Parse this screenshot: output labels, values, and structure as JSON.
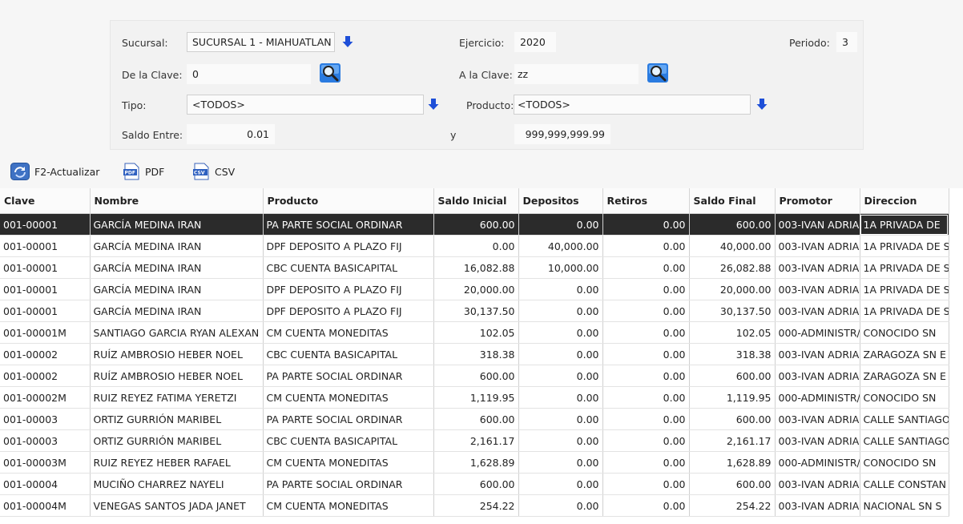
{
  "filters": {
    "sucursal_label": "Sucursal:",
    "sucursal_value": "SUCURSAL 1 - MIAHUATLAN",
    "ejercicio_label": "Ejercicio:",
    "ejercicio_value": "2020",
    "periodo_label": "Periodo:",
    "periodo_value": "3",
    "de_clave_label": "De la Clave:",
    "de_clave_value": "0",
    "a_clave_label": "A la Clave:",
    "a_clave_value": "zz",
    "tipo_label": "Tipo:",
    "tipo_value": "<TODOS>",
    "producto_label": "Producto:",
    "producto_value": "<TODOS>",
    "saldo_label": "Saldo Entre:",
    "saldo_min": "0.01",
    "y_label": "y",
    "saldo_max": "999,999,999.99"
  },
  "toolbar": {
    "refresh_label": "F2-Actualizar",
    "pdf_label": "PDF",
    "csv_label": "CSV"
  },
  "colors": {
    "selected_row": "#2b2b2b",
    "arrow_blue": "#1e4fd8"
  },
  "table": {
    "columns": [
      "Clave",
      "Nombre",
      "Producto",
      "Saldo Inicial",
      "Depositos",
      "Retiros",
      "Saldo Final",
      "Promotor",
      "Direccion"
    ],
    "rows": [
      [
        "001-00001",
        "GARCÍA MEDINA IRAN",
        "PA PARTE SOCIAL ORDINAR",
        "600.00",
        "0.00",
        "0.00",
        "600.00",
        "003-IVAN ADRIA",
        "1A PRIVADA DE"
      ],
      [
        "001-00001",
        "GARCÍA MEDINA IRAN",
        "DPF DEPOSITO A PLAZO FIJ",
        "0.00",
        "40,000.00",
        "0.00",
        "40,000.00",
        "003-IVAN ADRIA",
        "1A PRIVADA DE S"
      ],
      [
        "001-00001",
        "GARCÍA MEDINA IRAN",
        "CBC CUENTA BASICAPITAL",
        "16,082.88",
        "10,000.00",
        "0.00",
        "26,082.88",
        "003-IVAN ADRIA",
        "1A PRIVADA DE S"
      ],
      [
        "001-00001",
        "GARCÍA MEDINA IRAN",
        "DPF DEPOSITO A PLAZO FIJ",
        "20,000.00",
        "0.00",
        "0.00",
        "20,000.00",
        "003-IVAN ADRIA",
        "1A PRIVADA DE S"
      ],
      [
        "001-00001",
        "GARCÍA MEDINA IRAN",
        "DPF DEPOSITO A PLAZO FIJ",
        "30,137.50",
        "0.00",
        "0.00",
        "30,137.50",
        "003-IVAN ADRIA",
        "1A PRIVADA DE S"
      ],
      [
        "001-00001M",
        "SANTIAGO GARCIA RYAN ALEXAN",
        "CM CUENTA MONEDITAS",
        "102.05",
        "0.00",
        "0.00",
        "102.05",
        "000-ADMINISTR/",
        "CONOCIDO SN"
      ],
      [
        "001-00002",
        "RUÍZ AMBROSIO HEBER NOEL",
        "CBC CUENTA BASICAPITAL",
        "318.38",
        "0.00",
        "0.00",
        "318.38",
        "003-IVAN ADRIA",
        "ZARAGOZA SN E"
      ],
      [
        "001-00002",
        "RUÍZ AMBROSIO HEBER NOEL",
        "PA PARTE SOCIAL ORDINAR",
        "600.00",
        "0.00",
        "0.00",
        "600.00",
        "003-IVAN ADRIA",
        "ZARAGOZA SN E"
      ],
      [
        "001-00002M",
        "RUIZ REYEZ FATIMA YERETZI",
        "CM CUENTA MONEDITAS",
        "1,119.95",
        "0.00",
        "0.00",
        "1,119.95",
        "000-ADMINISTR/",
        "CONOCIDO SN"
      ],
      [
        "001-00003",
        "ORTIZ GURRIÓN MARIBEL",
        "PA PARTE SOCIAL ORDINAR",
        "600.00",
        "0.00",
        "0.00",
        "600.00",
        "003-IVAN ADRIA",
        "CALLE SANTIAGO"
      ],
      [
        "001-00003",
        "ORTIZ GURRIÓN MARIBEL",
        "CBC CUENTA BASICAPITAL",
        "2,161.17",
        "0.00",
        "0.00",
        "2,161.17",
        "003-IVAN ADRIA",
        "CALLE SANTIAGO"
      ],
      [
        "001-00003M",
        "RUIZ REYEZ HEBER RAFAEL",
        "CM CUENTA MONEDITAS",
        "1,628.89",
        "0.00",
        "0.00",
        "1,628.89",
        "000-ADMINISTR/",
        "CONOCIDO SN"
      ],
      [
        "001-00004",
        "MUCIÑO CHARREZ NAYELI",
        "PA PARTE SOCIAL ORDINAR",
        "600.00",
        "0.00",
        "0.00",
        "600.00",
        "003-IVAN ADRIA",
        "CALLE CONSTAN"
      ],
      [
        "001-00004M",
        "VENEGAS SANTOS JADA JANET",
        "CM CUENTA MONEDITAS",
        "254.22",
        "0.00",
        "0.00",
        "254.22",
        "003-IVAN ADRIA",
        "NACIONAL SN S"
      ]
    ]
  }
}
